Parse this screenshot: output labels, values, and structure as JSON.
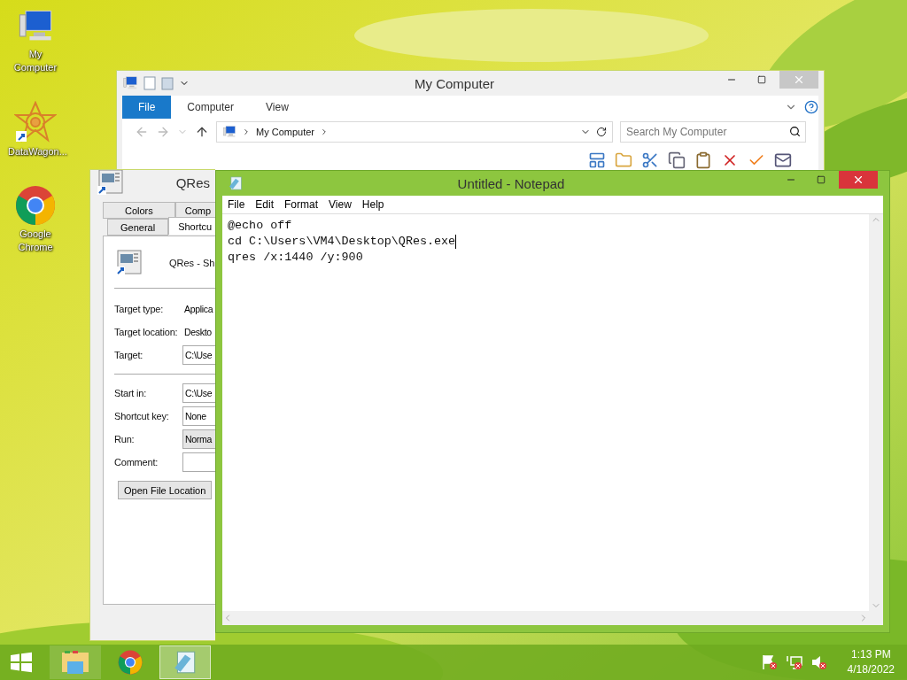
{
  "desktop_icons": [
    {
      "label": "My Computer",
      "kind": "computer"
    },
    {
      "label": "DataWagon...",
      "kind": "star"
    },
    {
      "label": "Google Chrome",
      "kind": "chrome"
    }
  ],
  "explorer": {
    "title": "My Computer",
    "ribbon_tabs": [
      {
        "label": "File",
        "selected": true
      },
      {
        "label": "Computer",
        "selected": false
      },
      {
        "label": "View",
        "selected": false
      }
    ],
    "address": "My Computer",
    "search": {
      "placeholder": "Search My Computer"
    }
  },
  "properties": {
    "title": "QRes",
    "tab_rows": [
      [
        {
          "label": "Colors",
          "selected": false
        },
        {
          "label": "Comp",
          "selected": false
        }
      ],
      [
        {
          "label": "General",
          "selected": false
        },
        {
          "label": "Shortcu",
          "selected": true
        }
      ]
    ],
    "name": "QRes - Sh",
    "fields_top": [
      {
        "label": "Target type:",
        "value": "Applica",
        "kind": "text"
      },
      {
        "label": "Target location:",
        "value": "Deskto",
        "kind": "text"
      },
      {
        "label": "Target:",
        "value": "C:\\Use",
        "kind": "input"
      }
    ],
    "fields_bottom": [
      {
        "label": "Start in:",
        "value": "C:\\Use",
        "kind": "input"
      },
      {
        "label": "Shortcut key:",
        "value": "None",
        "kind": "input"
      },
      {
        "label": "Run:",
        "value": "Norma",
        "kind": "select"
      },
      {
        "label": "Comment:",
        "kind": "input"
      }
    ],
    "button": "Open File Location"
  },
  "notepad": {
    "title": "Untitled - Notepad",
    "menu": [
      "File",
      "Edit",
      "Format",
      "View",
      "Help"
    ],
    "lines": [
      "@echo off",
      "cd C:\\Users\\VM4\\Desktop\\QRes.exe",
      "qres /x:1440 /y:900"
    ]
  },
  "taskbar": {
    "items": [
      {
        "kind": "explorer",
        "selected": false
      },
      {
        "kind": "chrome",
        "selected": false
      },
      {
        "kind": "notepad",
        "selected": true
      }
    ],
    "time": "1:13 PM",
    "date": "4/18/2022"
  }
}
